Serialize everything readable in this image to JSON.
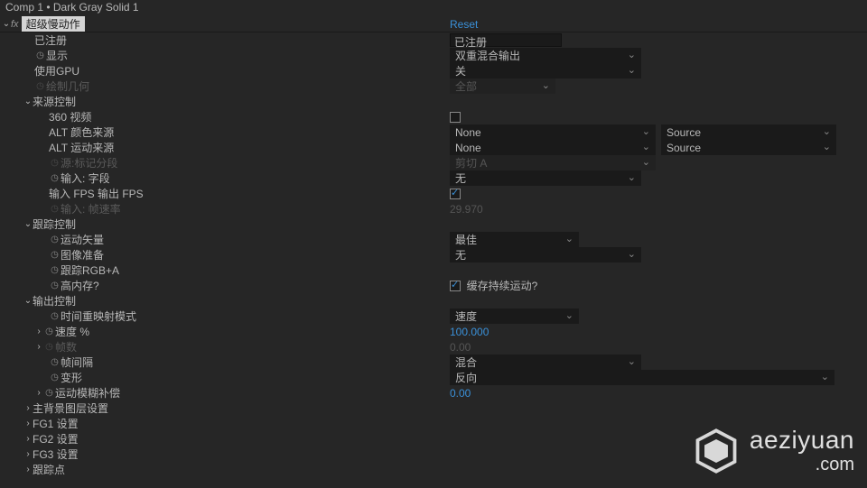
{
  "titlebar": "Comp 1 • Dark Gray Solid 1",
  "fx": {
    "name": "超级慢动作",
    "reset": "Reset"
  },
  "labels": {
    "registered": "已注册",
    "display": "显示",
    "useGPU": "使用GPU",
    "drawGeom": "绘制几何",
    "sourceCtrl": "来源控制",
    "video360": "360 视频",
    "altColor": "ALT 颜色来源",
    "altMotion": "ALT 运动来源",
    "srcMarker": "源:标记分段",
    "inputField": "输入: 字段",
    "ioFPS": "输入 FPS 输出 FPS",
    "inputFrameRate": "输入: 帧速率",
    "trackCtrl": "跟踪控制",
    "motionVec": "运动矢量",
    "imagePrep": "图像准备",
    "trackRGBA": "跟踪RGB+A",
    "highMem": "高内存?",
    "cacheMotion": "缓存持续运动?",
    "outputCtrl": "输出控制",
    "timeRemap": "时间重映射模式",
    "speedPct": "速度 %",
    "frames": "帧数",
    "frameGap": "帧间隔",
    "deform": "变形",
    "motionBlur": "运动模糊补偿",
    "mainBG": "主背景图层设置",
    "fg1": "FG1 设置",
    "fg2": "FG2 设置",
    "fg3": "FG3 设置",
    "trackPt": "跟踪点"
  },
  "values": {
    "registeredInput": "已注册",
    "display": "双重混合输出",
    "useGPU": "关",
    "drawGeom": "全部",
    "altColor": "None",
    "altColorSrc": "Source",
    "altMotion": "None",
    "altMotionSrc": "Source",
    "srcMarker": "剪切 A",
    "inputField": "无",
    "inputFrameRate": "29.970",
    "motionVec": "最佳",
    "imagePrep": "无",
    "timeRemap": "速度",
    "speedPct": "100.000",
    "frames": "0.00",
    "frameGap": "混合",
    "deform": "反向",
    "motionBlur": "0.00"
  },
  "watermark": {
    "line1": "aeziyuan",
    "line2": ".com"
  }
}
